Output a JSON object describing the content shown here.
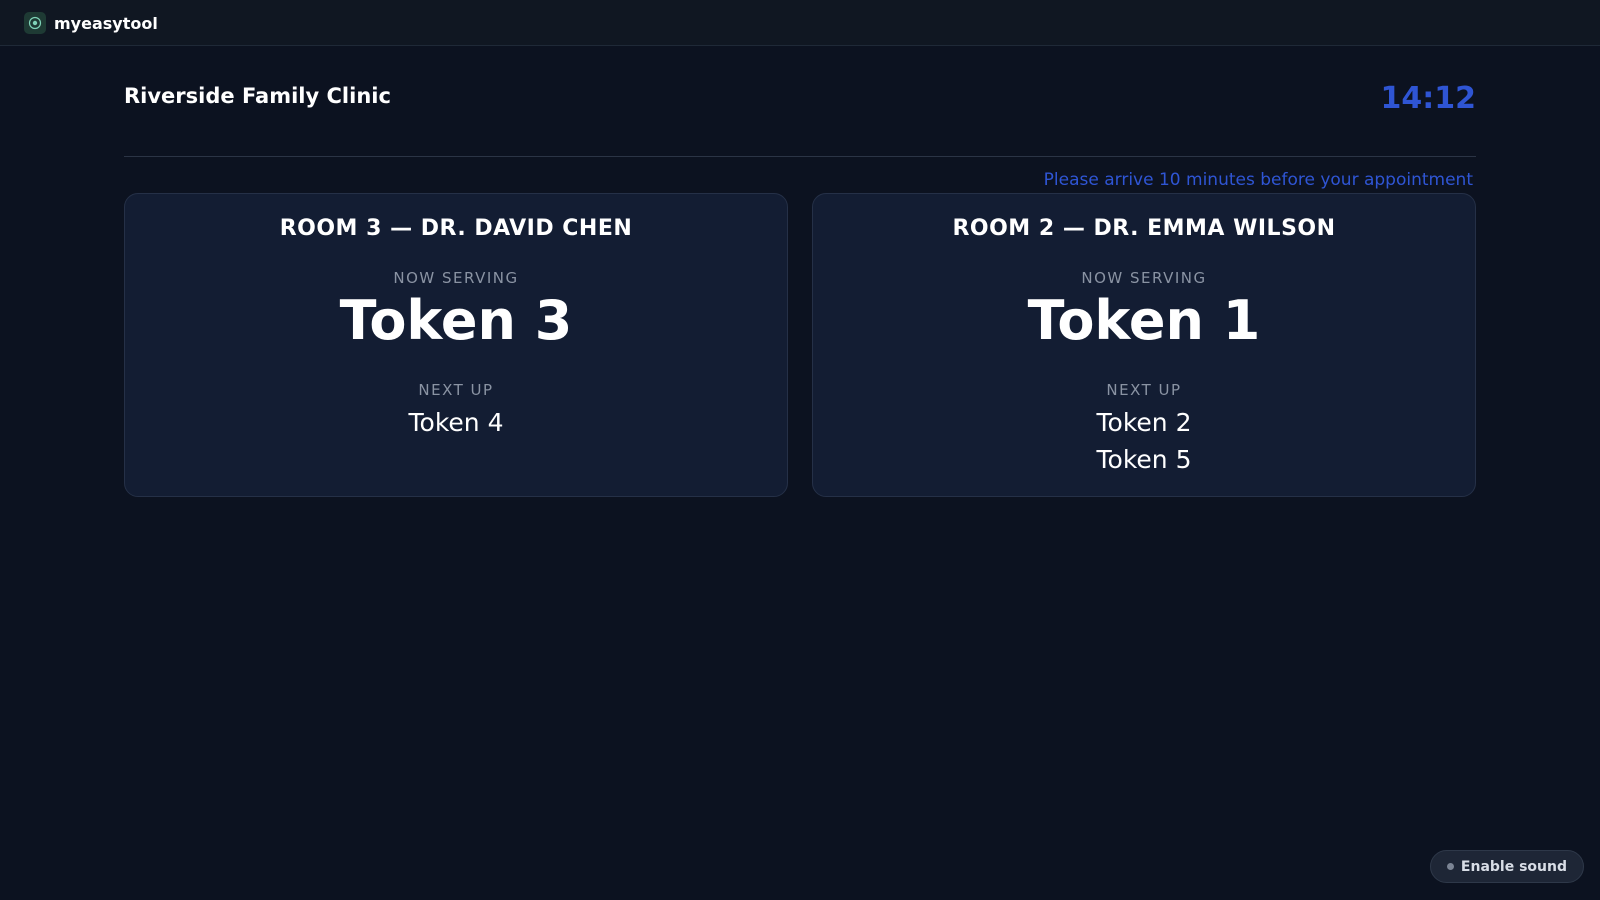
{
  "app": {
    "brand_name": "myeasytool",
    "brand_icon": "logo-icon"
  },
  "header": {
    "clinic_name": "Riverside Family Clinic",
    "time": "14:12",
    "notice": "Please arrive 10 minutes before your appointment"
  },
  "rooms": [
    {
      "title": "ROOM 3 — DR. DAVID CHEN",
      "now_serving_label": "NOW SERVING",
      "now_serving": "Token 3",
      "next_up_label": "NEXT UP",
      "next_up": [
        "Token 4"
      ]
    },
    {
      "title": "ROOM 2 — DR. EMMA WILSON",
      "now_serving_label": "NOW SERVING",
      "now_serving": "Token 1",
      "next_up_label": "NEXT UP",
      "next_up": [
        "Token 2",
        "Token 5"
      ]
    }
  ],
  "controls": {
    "sound_label": "Enable sound",
    "sound_icon": "status-dot-icon"
  },
  "colors": {
    "background": "#0c1220",
    "card": "#131d33",
    "accent": "#2f55d4",
    "muted": "#8a93a3"
  }
}
